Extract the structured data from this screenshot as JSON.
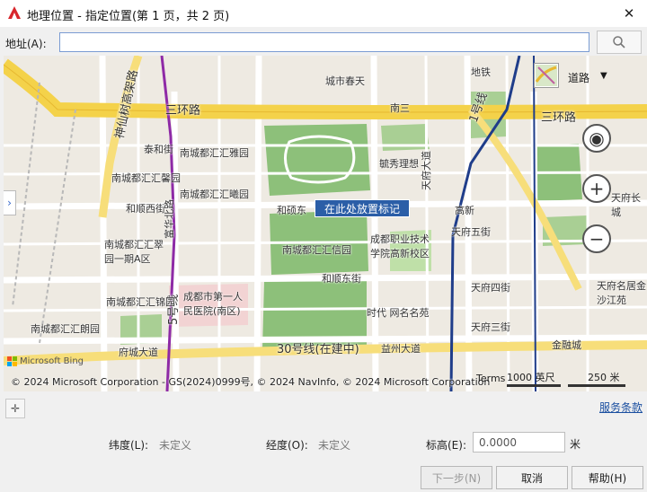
{
  "window": {
    "title": "地理位置 - 指定位置(第 1 页，共 2 页)",
    "close_glyph": "✕"
  },
  "address": {
    "label": "地址(A):",
    "value": ""
  },
  "map": {
    "layer_label": "道路",
    "place_marker_label": "在此处放置标记",
    "road_labels": [
      "三环路",
      "三环路",
      "神仙树高架路",
      "1号线",
      "30号线(在建中)",
      "府城大道",
      "天府大道",
      "5号线"
    ],
    "place_labels": [
      "南城都汇汇雅园",
      "南城都汇汇馨园",
      "南城都汇汇曦园",
      "和顺西街",
      "南城都汇汇翠园一期A区",
      "南城都汇汇锦园",
      "南城都汇汇朗园",
      "南城都汇汇信园",
      "和硕东",
      "和顺东街",
      "成都职业技术学院高新校区",
      "天府五街",
      "天府四街",
      "天府三街",
      "时代 网名名苑",
      "益州大道",
      "成都市第一人民医院(南区)",
      "高新",
      "金融城",
      "天府长城",
      "天府名居金沙江苑",
      "城市春天",
      "南三",
      "毓秀理想",
      "富华北路",
      "地铁",
      "泰和街"
    ],
    "copyright": "© 2024 Microsoft Corporation - GS(2024)0999号, © 2024 NavInfo, © 2024 Microsoft Corporation",
    "terms": "Terms",
    "scale_primary": "1000 英尺",
    "scale_secondary": "250 米",
    "bing_label": "Microsoft Bing"
  },
  "footer": {
    "terms_link": "服务条款",
    "latitude_label": "纬度(L):",
    "latitude_value": "未定义",
    "longitude_label": "经度(O):",
    "longitude_value": "未定义",
    "elevation_label": "标高(E):",
    "elevation_value": "0.0000",
    "elevation_unit": "米"
  },
  "buttons": {
    "next": "下一步(N)",
    "cancel": "取消",
    "help": "帮助(H)"
  },
  "colors": {
    "accent": "#2b5ea7",
    "link": "#1a4fa0",
    "ring_road": "#f4d24a",
    "park": "#7fb86e",
    "metro_purple": "#8e2aa6",
    "metro_blue": "#1f3d8a"
  }
}
